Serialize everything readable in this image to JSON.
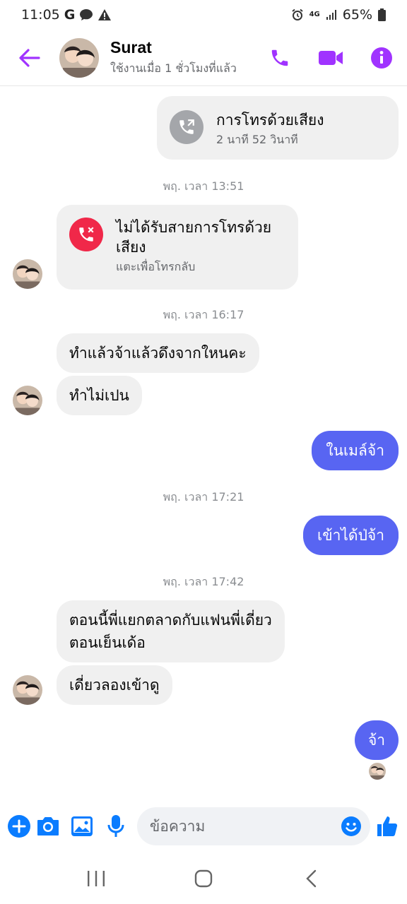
{
  "status_bar": {
    "time": "11:05",
    "g_icon": "G",
    "network": "4G",
    "battery": "65%",
    "icons": [
      "google-icon",
      "chat-bubble-icon",
      "warning-icon",
      "alarm-icon",
      "signal-icon",
      "battery-icon"
    ]
  },
  "header": {
    "contact_name": "Surat",
    "contact_status": "ใช้งานเมื่อ 1 ชั่วโมงที่แล้ว",
    "accent_color": "#a033ff"
  },
  "messages": {
    "call1": {
      "title": "การโทรด้วยเสียง",
      "sub": "2 นาที 52 วินาที"
    },
    "ts1": "พฤ. เวลา 13:51",
    "missed": {
      "title_line1": "ไม่ได้รับสายการโทรด้วย",
      "title_line2": "เสียง",
      "sub": "แตะเพื่อโทรกลับ"
    },
    "ts2": "พฤ. เวลา 16:17",
    "in1": "ทำแล้วจ้าแล้วดึงจากใหนคะ",
    "in2": "ทำไม่เปน",
    "out1": "ในเมล์จ้า",
    "ts3": "พฤ. เวลา 17:21",
    "out2": "เข้าได้ป่จ้า",
    "ts4": "พฤ. เวลา 17:42",
    "in3_line1": "ตอนนี้พี่แยกตลาดกับแฟนพี่เดี่ยว",
    "in3_line2": "ตอนเย็นเด้อ",
    "in4": "เดี่ยวลองเข้าดู",
    "out3": "จ้า"
  },
  "composer": {
    "placeholder": "ข้อความ"
  },
  "colors": {
    "outgoing_bubble": "#5865f2",
    "incoming_bubble": "#f0f0f0",
    "composer_blue": "#0a7cff",
    "missed_red": "#f02849"
  }
}
